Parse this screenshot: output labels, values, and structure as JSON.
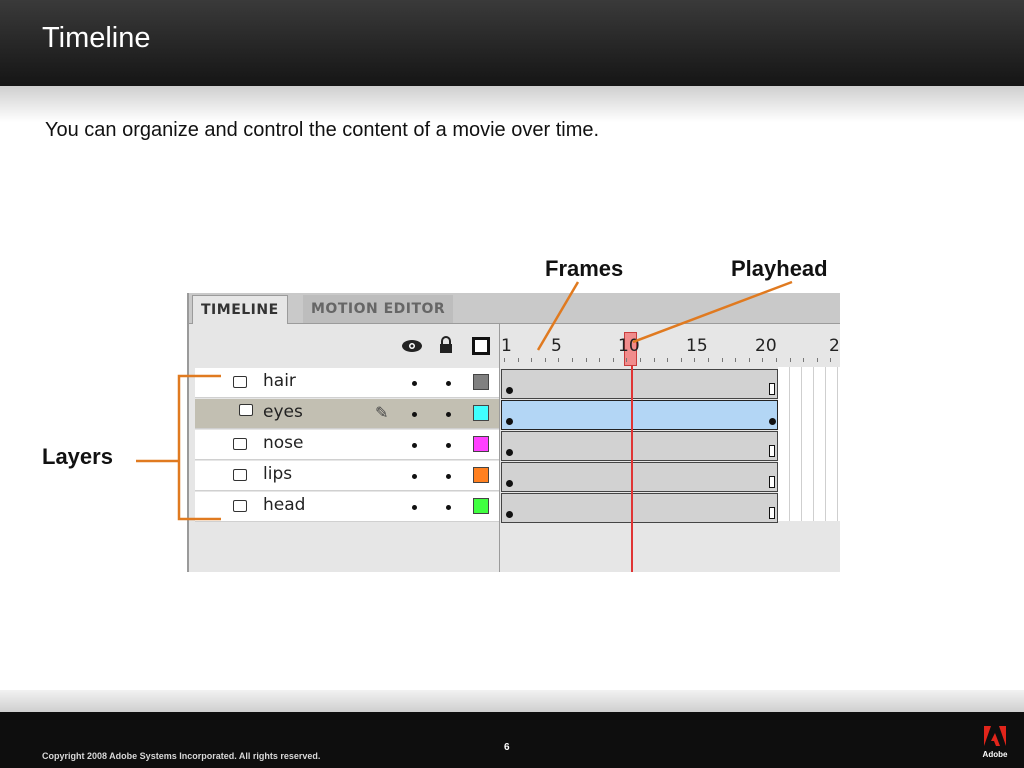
{
  "slide": {
    "title": "Timeline",
    "subtitle": "You can organize and control the content of a movie over time."
  },
  "callouts": {
    "frames": "Frames",
    "playhead": "Playhead",
    "layers": "Layers"
  },
  "timeline": {
    "tabs": [
      {
        "label": "TIMELINE",
        "active": true
      },
      {
        "label": "MOTION EDITOR",
        "active": false
      }
    ],
    "header_icons": [
      "eye-icon",
      "lock-icon",
      "outline-icon"
    ],
    "ruler_labels": [
      "1",
      "5",
      "10",
      "15",
      "20",
      "2"
    ],
    "playhead_frame": 10,
    "layers": [
      {
        "name": "hair",
        "color": "#808080",
        "selected": false
      },
      {
        "name": "eyes",
        "color": "#40ffff",
        "selected": true
      },
      {
        "name": "nose",
        "color": "#ff40ff",
        "selected": false
      },
      {
        "name": "lips",
        "color": "#ff8020",
        "selected": false
      },
      {
        "name": "head",
        "color": "#40ff40",
        "selected": false
      }
    ]
  },
  "footer": {
    "page_number": "6",
    "copyright": "Copyright 2008 Adobe Systems Incorporated.  All rights reserved.",
    "logo_text": "Adobe"
  },
  "colors": {
    "callout_line": "#e07a20",
    "playhead": "#e03434",
    "selected_frames": "#b3d6f5"
  }
}
